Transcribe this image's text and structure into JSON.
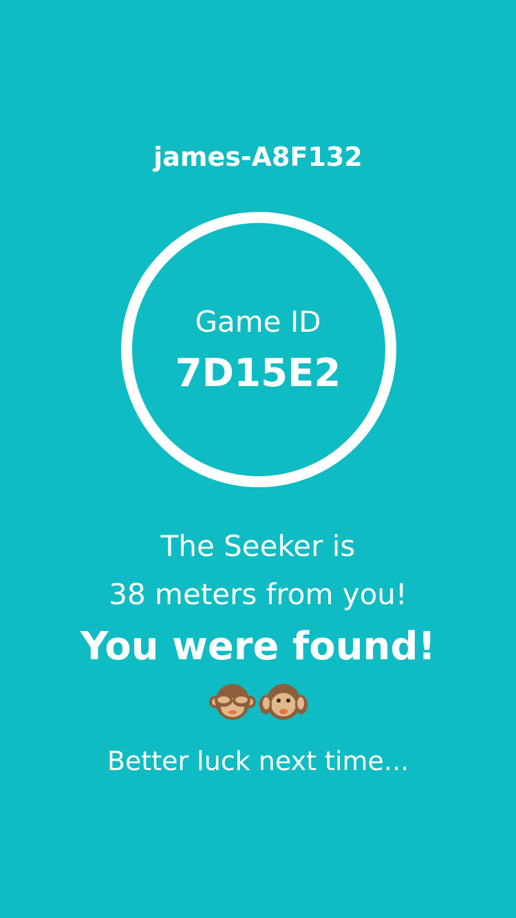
{
  "player": {
    "username": "james-A8F132"
  },
  "game": {
    "id_label": "Game ID",
    "id_value": "7D15E2"
  },
  "status": {
    "line1": "The Seeker is",
    "line2": "38 meters from you!",
    "headline": "You were found!",
    "emojis": [
      "see-no-evil-monkey",
      "hear-no-evil-monkey"
    ],
    "footer": "Better luck next time..."
  },
  "colors": {
    "background": "#0fbcc3",
    "text": "#ffffff",
    "monkey_fur": "#8d5e3c",
    "monkey_face": "#e0b98a",
    "monkey_mouth": "#e8734a"
  }
}
